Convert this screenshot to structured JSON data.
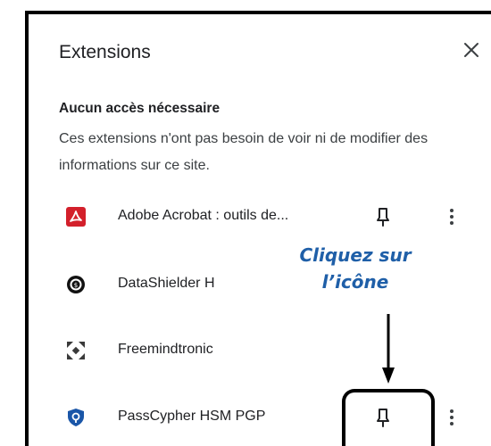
{
  "panel": {
    "title": "Extensions",
    "section_heading": "Aucun accès nécessaire",
    "section_description": "Ces extensions n'ont pas besoin de voir ni de modifier des informations sur ce site."
  },
  "extensions": [
    {
      "name": "Adobe Acrobat : outils de...",
      "icon": "adobe-acrobat-icon",
      "pin_visible": true
    },
    {
      "name": "DataShielder H",
      "icon": "datashielder-icon",
      "pin_visible": false
    },
    {
      "name": "Freemindtronic",
      "icon": "freemindtronic-icon",
      "pin_visible": false
    },
    {
      "name": "PassCypher HSM PGP",
      "icon": "passcypher-icon",
      "pin_visible": true
    }
  ],
  "annotation": {
    "line1": "Cliquez sur",
    "line2": "l’icône",
    "color": "#1f5fa8"
  },
  "colors": {
    "adobe_red": "#d3202b",
    "passcypher_blue": "#1a56a8",
    "text": "#202124"
  }
}
